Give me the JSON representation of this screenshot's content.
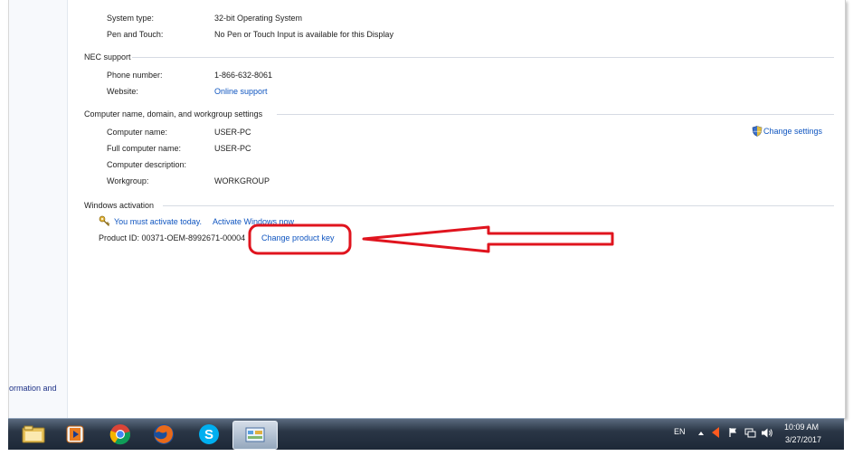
{
  "system": {
    "rows": [
      {
        "label": "System type:",
        "value": "32-bit Operating System"
      },
      {
        "label": "Pen and Touch:",
        "value": "No Pen or Touch Input is available for this Display"
      }
    ]
  },
  "support": {
    "title": "NEC support",
    "phone_label": "Phone number:",
    "phone_value": "1-866-632-8061",
    "website_label": "Website:",
    "website_link": "Online support"
  },
  "computer": {
    "title": "Computer name, domain, and workgroup settings",
    "change_settings": "Change settings",
    "rows": [
      {
        "label": "Computer name:",
        "value": "USER-PC"
      },
      {
        "label": "Full computer name:",
        "value": "USER-PC"
      },
      {
        "label": "Computer description:",
        "value": ""
      },
      {
        "label": "Workgroup:",
        "value": "WORKGROUP"
      }
    ]
  },
  "activation": {
    "title": "Windows activation",
    "warning": "You must activate today.",
    "activate_link": "Activate Windows now",
    "product_id": "Product ID: 00371-OEM-8992671-00004",
    "change_key": "Change product key"
  },
  "left_pane": {
    "link_fragment": "ormation and"
  },
  "annotation": {
    "color": "#e0141e"
  },
  "taskbar": {
    "language": "EN",
    "time": "10:09 AM",
    "date": "3/27/2017",
    "apps": [
      "file-explorer-icon",
      "media-player-icon",
      "chrome-icon",
      "firefox-icon",
      "skype-icon",
      "control-panel-icon"
    ]
  }
}
